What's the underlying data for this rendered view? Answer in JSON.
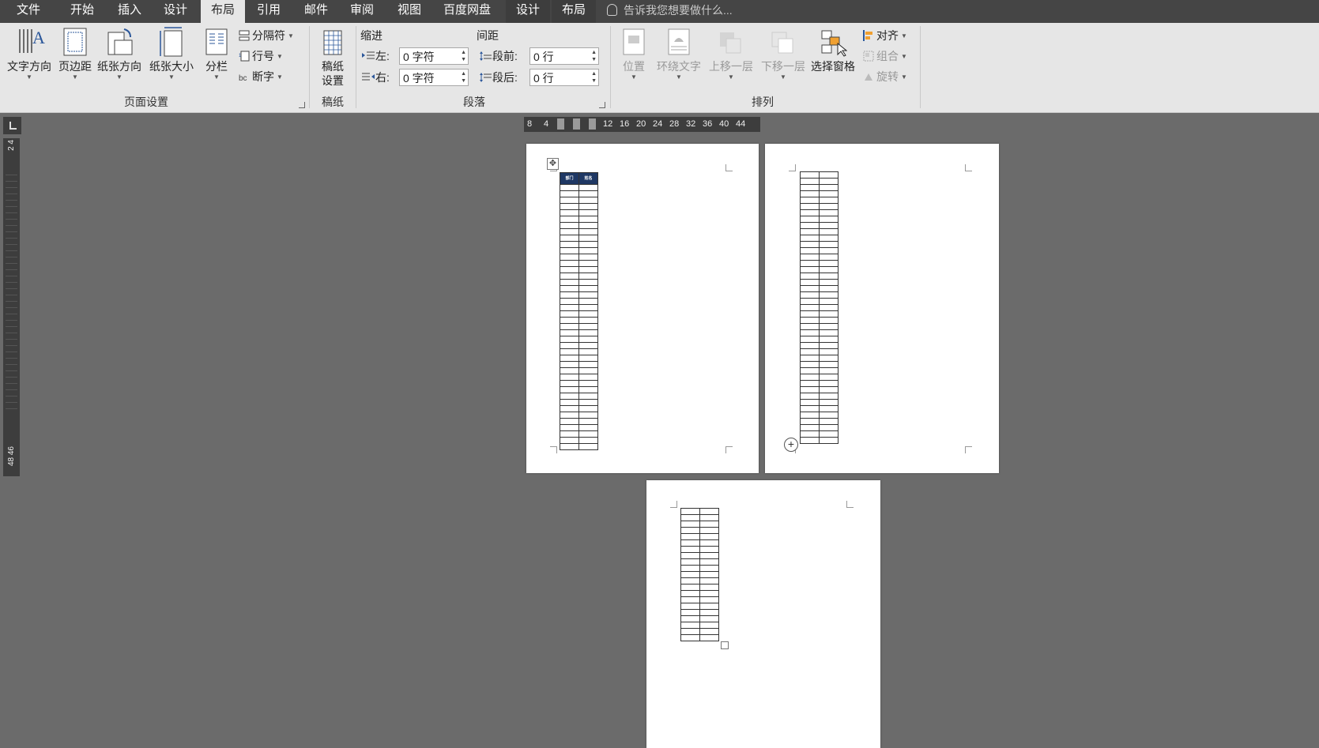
{
  "menu": {
    "tabs": [
      "文件",
      "开始",
      "插入",
      "设计",
      "布局",
      "引用",
      "邮件",
      "审阅",
      "视图",
      "百度网盘",
      "设计",
      "布局"
    ],
    "active_index": 4,
    "tell_me": "告诉我您想要做什么..."
  },
  "ribbon": {
    "page_setup": {
      "label": "页面设置",
      "text_direction": "文字方向",
      "margins": "页边距",
      "orientation": "纸张方向",
      "size": "纸张大小",
      "columns": "分栏",
      "breaks": "分隔符",
      "line_numbers": "行号",
      "hyphenation": "断字"
    },
    "draft": {
      "label": "稿纸",
      "draft_setup_line1": "稿纸",
      "draft_setup_line2": "设置"
    },
    "paragraph": {
      "label": "段落",
      "indent_title": "缩进",
      "spacing_title": "间距",
      "left_label": "左:",
      "left_value": "0 字符",
      "right_label": "右:",
      "right_value": "0 字符",
      "before_label": "段前:",
      "before_value": "0 行",
      "after_label": "段后:",
      "after_value": "0 行"
    },
    "arrange": {
      "label": "排列",
      "position": "位置",
      "wrap_text": "环绕文字",
      "bring_forward": "上移一层",
      "send_backward": "下移一层",
      "selection_pane": "选择窗格",
      "align": "对齐",
      "group": "组合",
      "rotate": "旋转"
    }
  },
  "ruler": {
    "h_ticks": [
      "8",
      "4",
      "12",
      "16",
      "20",
      "24",
      "28",
      "32",
      "36",
      "40",
      "44"
    ],
    "v_top": "2 4",
    "v_bottom": "48 46"
  },
  "table": {
    "headers": [
      "部门",
      "姓名"
    ],
    "page1_rows": 42,
    "page2_rows": 43,
    "page3_rows": 21
  },
  "colors": {
    "menubar": "#454545",
    "ribbon": "#e6e6e6",
    "canvas": "#6b6b6b",
    "table_header": "#1f3864"
  }
}
